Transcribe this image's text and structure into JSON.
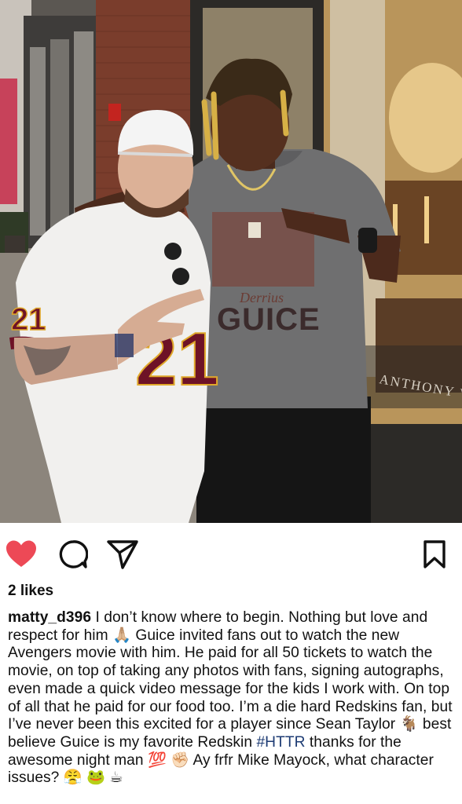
{
  "post": {
    "likes_text": "2 likes",
    "username": "matty_d396",
    "caption_1": " I don’t know where to begin. Nothing but love and respect for him 🙏🏼 Guice invited fans out to watch the new Avengers movie with him. He paid for all 50 tickets to watch the movie, on top of taking any photos with fans, signing autographs, even made a quick video message for the kids I work with. On top of all that he paid for our food too. I’m a die hard Redskins fan, but I’ve never been this excited for a player since Sean Taylor 🐐 best believe Guice is my favorite Redskin ",
    "hashtag": "#HTTR",
    "caption_2": " thanks for the awesome night man 💯 ✊🏻 Ay frfr Mike Mayock, what character issues? 😤 🐸 ☕",
    "photo": {
      "jersey_number": "21",
      "shirt_text_script": "Derrius",
      "shirt_text": "GUICE",
      "window_text": "ANTHONY V"
    }
  },
  "icons": {
    "like": "heart-icon",
    "comment": "speech-bubble-icon",
    "share": "paper-plane-icon",
    "save": "bookmark-icon"
  },
  "colors": {
    "like_red": "#ed4956",
    "hashtag_blue": "#1d3b73"
  }
}
